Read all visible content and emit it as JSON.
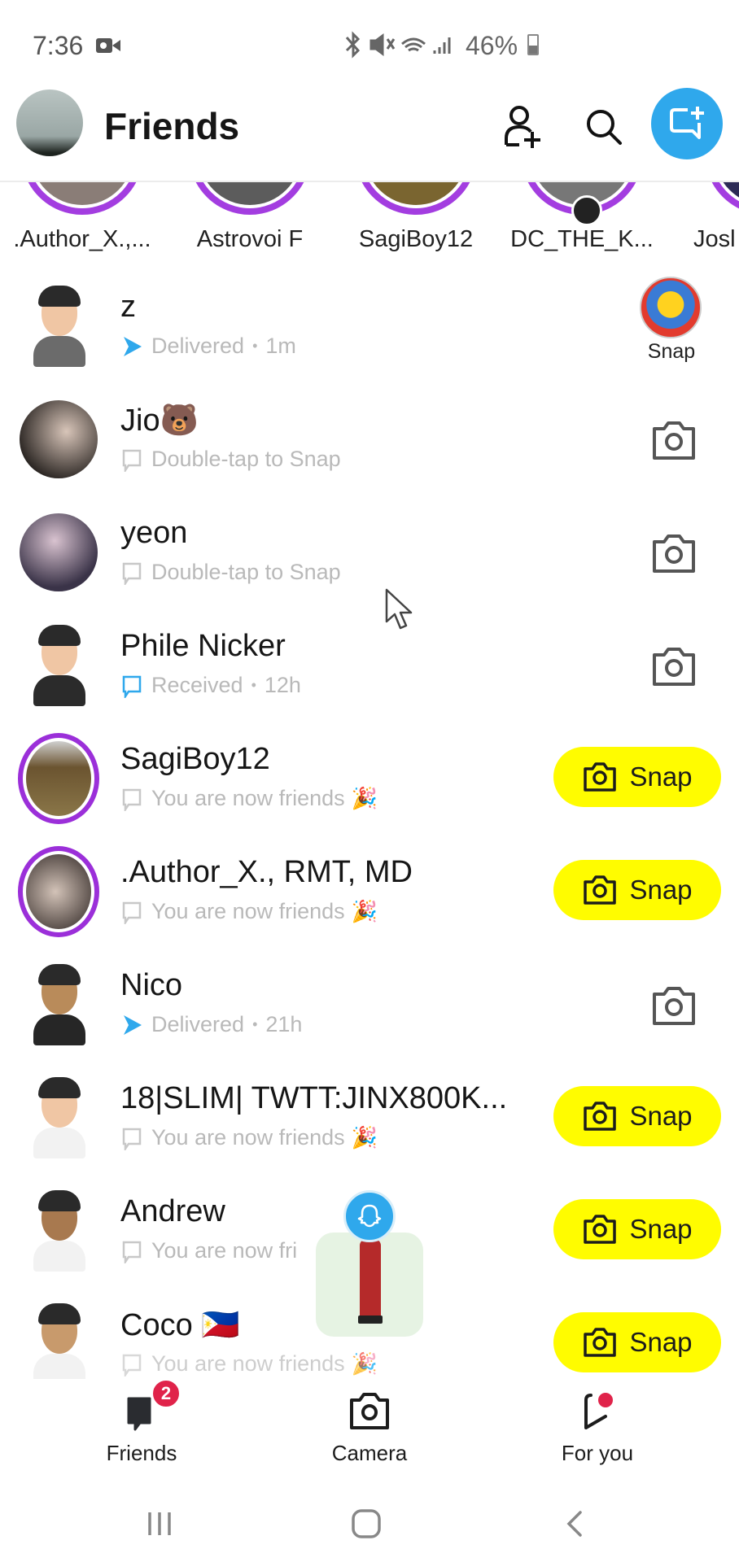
{
  "status_bar": {
    "time": "7:36",
    "status_icons": "✱ 🔇 📶",
    "battery_percent": "46%",
    "battery_level": 0.46
  },
  "header": {
    "title": "Friends",
    "icons": [
      "add-friend-icon",
      "search-icon",
      "new-chat-icon"
    ]
  },
  "stories": [
    {
      "name": ".Author_X.,..."
    },
    {
      "name": "Astrovoi F"
    },
    {
      "name": "SagiBoy12"
    },
    {
      "name": "DC_THE_K..."
    },
    {
      "name": "Josl"
    }
  ],
  "friends": [
    {
      "name": "z",
      "status": "Delivered",
      "time": "1m",
      "status_type": "delivered",
      "action": "sticker",
      "action_label": "Snap"
    },
    {
      "name": "Jio🐻",
      "status": "Double-tap to Snap",
      "time": "",
      "status_type": "chat",
      "action": "camera"
    },
    {
      "name": "yeon",
      "status": "Double-tap to Snap",
      "time": "",
      "status_type": "chat",
      "action": "camera"
    },
    {
      "name": "Phile Nicker",
      "status": "Received",
      "time": "12h",
      "status_type": "received",
      "action": "camera"
    },
    {
      "name": "SagiBoy12",
      "status": "You are now friends",
      "time": "",
      "status_type": "chat",
      "confetti": "🎉",
      "action": "snap",
      "action_label": "Snap"
    },
    {
      "name": ".Author_X., RMT, MD",
      "status": "You are now friends",
      "time": "",
      "status_type": "chat",
      "confetti": "🎉",
      "action": "snap",
      "action_label": "Snap"
    },
    {
      "name": "Nico",
      "status": "Delivered",
      "time": "21h",
      "status_type": "delivered",
      "action": "camera"
    },
    {
      "name": "18|SLIM| TWTT:JINX800K...",
      "status": "You are now friends",
      "time": "",
      "status_type": "chat",
      "confetti": "🎉",
      "action": "snap",
      "action_label": "Snap"
    },
    {
      "name": "Andrew",
      "status": "You are now fri",
      "time": "",
      "status_type": "chat",
      "action": "snap",
      "action_label": "Snap"
    },
    {
      "name": "Coco 🇵🇭",
      "status": "You are now friends",
      "time": "",
      "status_type": "chat",
      "confetti": "🎉",
      "action": "snap",
      "action_label": "Snap"
    }
  ],
  "bottom_nav": {
    "items": [
      {
        "label": "Friends",
        "badge": "2"
      },
      {
        "label": "Camera"
      },
      {
        "label": "For you"
      }
    ]
  },
  "colors": {
    "snap_yellow": "#fffc00",
    "story_purple": "#a33de0",
    "accent_blue": "#2fa8ec",
    "badge_red": "#e0234a",
    "status_gray": "#b9b9b9"
  }
}
